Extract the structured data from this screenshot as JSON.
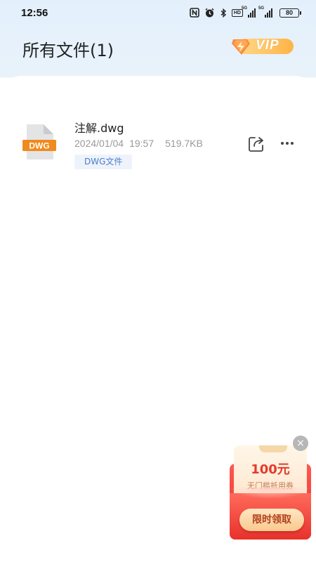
{
  "status_bar": {
    "time": "12:56",
    "battery": "80",
    "hd_label": "HD",
    "signal1_label": "5G",
    "signal2_label": "5G",
    "icons": [
      "nfc-icon",
      "alarm-icon",
      "bluetooth-icon",
      "hd-icon",
      "signal-icon",
      "signal-icon",
      "battery-icon"
    ]
  },
  "header": {
    "title": "所有文件(1)",
    "vip_label": "VIP"
  },
  "files": [
    {
      "name": "注解.dwg",
      "date": "2024/01/04",
      "time": "19:57",
      "size": "519.7KB",
      "tag": "DWG文件",
      "icon_label": "DWG"
    }
  ],
  "coupon": {
    "amount": "100元",
    "description": "无门槛抵用券",
    "button_label": "限时领取",
    "close_glyph": "×"
  },
  "colors": {
    "accent_blue": "#4a7fc9",
    "dwg_orange": "#f08a1c",
    "coupon_red": "#e42a2a"
  }
}
